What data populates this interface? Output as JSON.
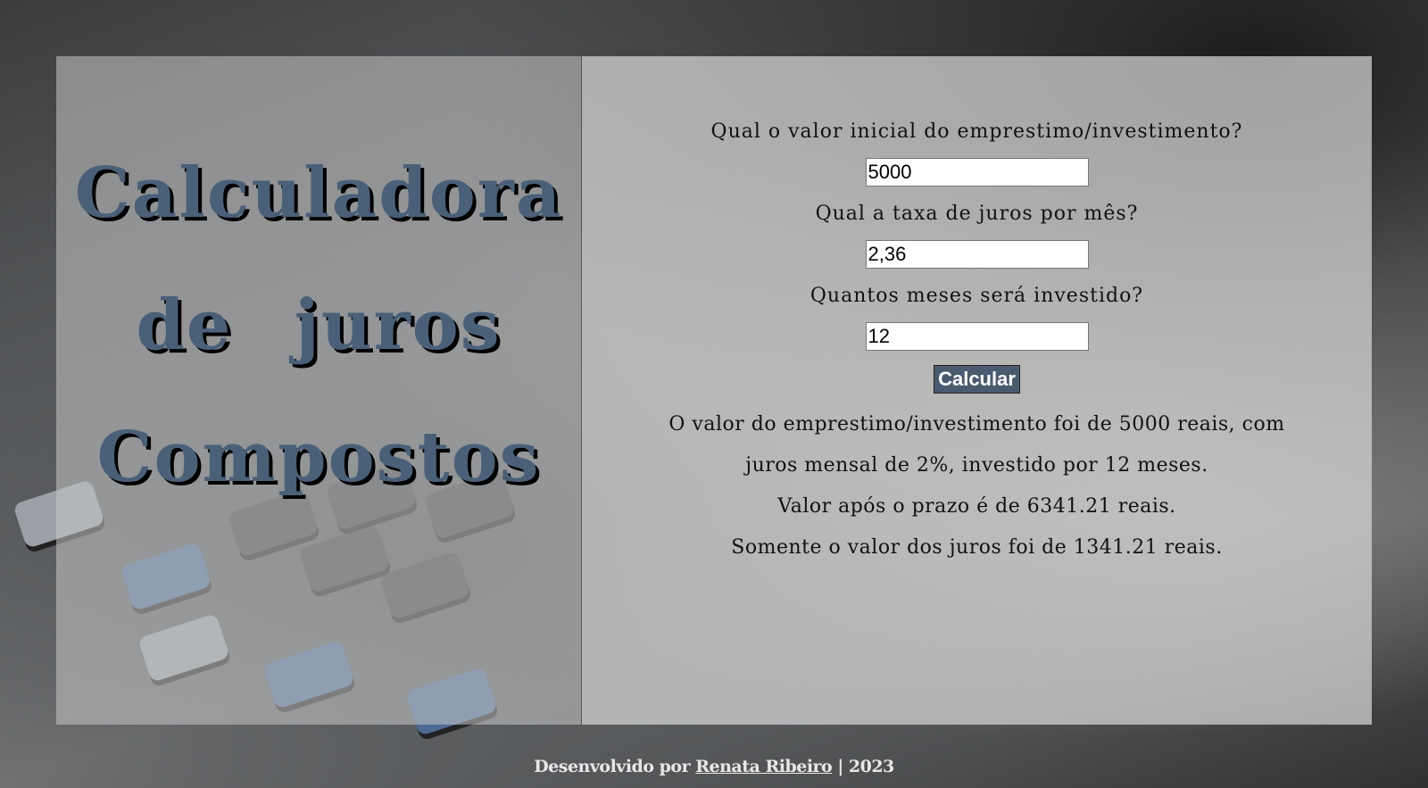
{
  "title": {
    "line1": "Calculadora",
    "line2": "de juros",
    "line3": "Compostos"
  },
  "form": {
    "initial_value_label": "Qual o valor inicial do emprestimo/investimento?",
    "initial_value": "5000",
    "rate_label": "Qual a taxa de juros por mês?",
    "rate_value": "2,36",
    "months_label": "Quantos meses será investido?",
    "months_value": "12",
    "calculate_label": "Calcular"
  },
  "result": {
    "line1": "O valor do emprestimo/investimento foi de 5000 reais, com",
    "line2": "juros mensal de 2%, investido por 12 meses.",
    "line3": "Valor após o prazo é de 6341.21 reais.",
    "line4": "Somente o valor dos juros foi de 1341.21 reais."
  },
  "footer": {
    "prefix": "Desenvolvido por",
    "author": "Renata Ribeiro",
    "suffix": "| 2023"
  },
  "colors": {
    "title": "#4a6078",
    "button": "#4a5b70"
  }
}
